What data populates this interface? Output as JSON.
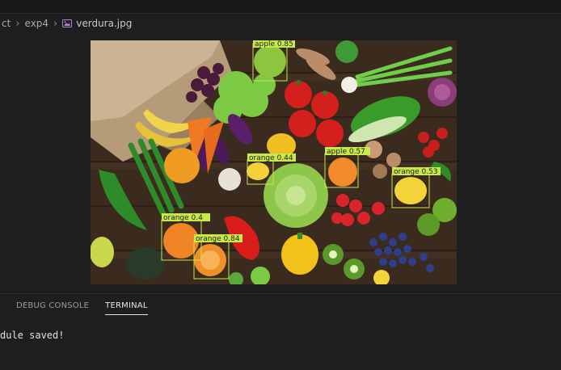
{
  "breadcrumb": {
    "items": [
      "ct",
      "exp4",
      "verdura.jpg"
    ]
  },
  "image": {
    "file_name": "verdura.jpg",
    "detections": [
      {
        "label": "apple 0.85"
      },
      {
        "label": "orange 0.44"
      },
      {
        "label": "apple 0.57"
      },
      {
        "label": "orange 0.53"
      },
      {
        "label": "orange 0.4"
      },
      {
        "label": "orange 0.84"
      }
    ]
  },
  "panel": {
    "tabs": [
      "DEBUG CONSOLE",
      "TERMINAL"
    ],
    "active_tab": "TERMINAL"
  },
  "terminal": {
    "lines": [
      "dule saved!"
    ]
  },
  "colors": {
    "detection_box": "#c9e84a",
    "detection_label_bg": "#c9e84a",
    "tab_underline": "#e7e7e7"
  }
}
